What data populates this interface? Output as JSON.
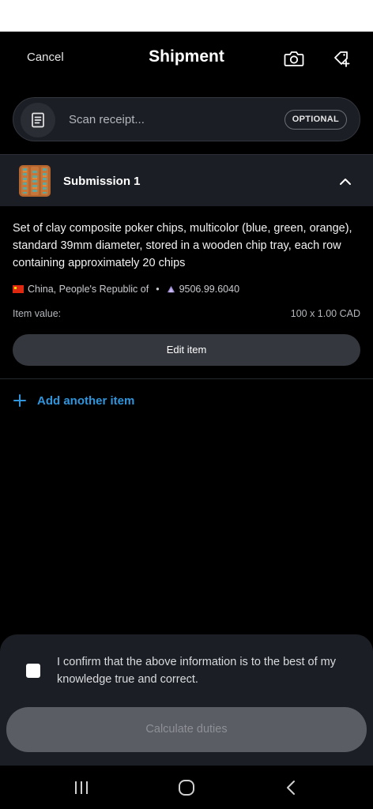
{
  "header": {
    "cancel_label": "Cancel",
    "title": "Shipment",
    "camera_icon": "camera-icon",
    "tag_add_icon": "tag-add-icon"
  },
  "scan": {
    "placeholder": "Scan receipt...",
    "badge": "OPTIONAL",
    "icon": "document-icon"
  },
  "submission": {
    "title": "Submission 1",
    "description": "Set of clay composite poker chips, multicolor (blue, green, orange), standard 39mm diameter, stored in a wooden chip tray, each row containing approximately 20 chips",
    "origin": "China, People's Republic of",
    "separator": "•",
    "hs_code": "9506.99.6040",
    "value_label": "Item value:",
    "value_amount": "100 x 1.00 CAD",
    "edit_label": "Edit item"
  },
  "add_item_label": "Add another item",
  "confirm": {
    "text": "I confirm that the above information is to the best of my knowledge true and correct.",
    "checked": false
  },
  "calculate_label": "Calculate duties",
  "colors": {
    "accent": "#2f95dc",
    "background": "#000000",
    "surface": "#1b1e24",
    "button": "#34373d",
    "disabled_button": "#5a5d63"
  }
}
